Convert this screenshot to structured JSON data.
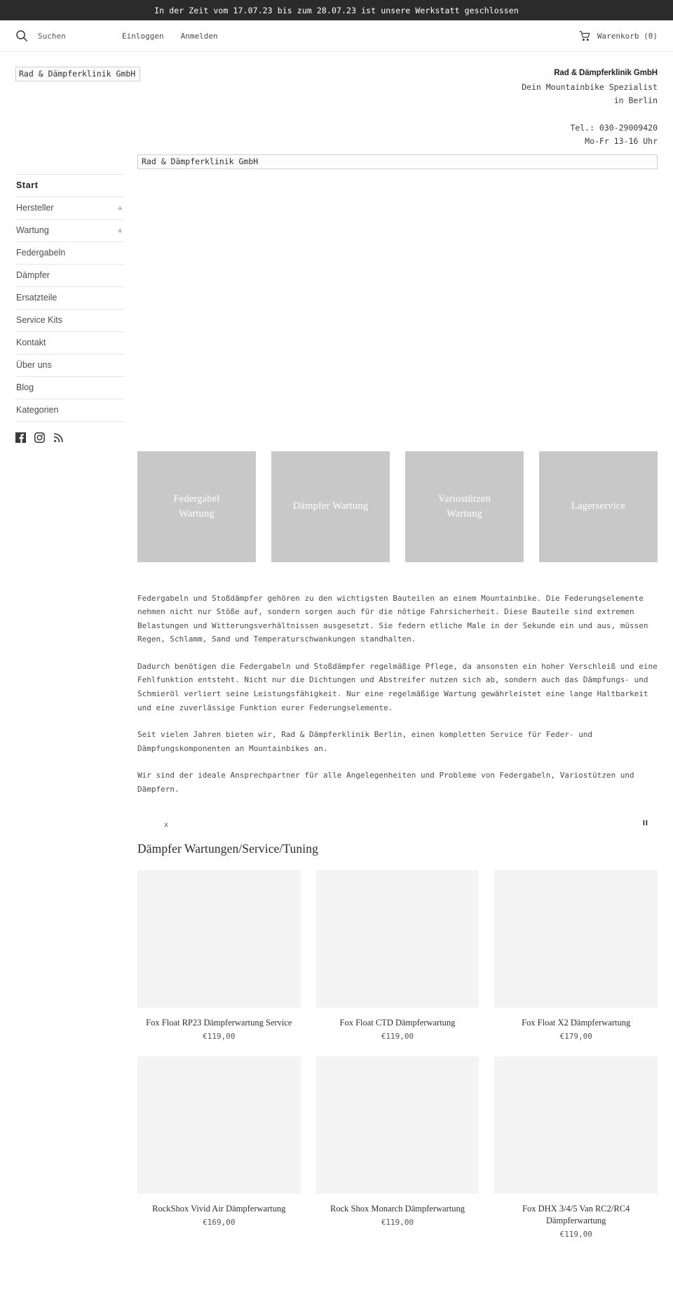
{
  "announcement": {
    "text": "In der Zeit vom 17.07.23 bis zum 28.07.23 ist unsere Werkstatt geschlossen"
  },
  "topbar": {
    "search_placeholder": "Suchen",
    "search_value": "",
    "search_icon": "search-icon",
    "links": [
      {
        "label": "Einloggen"
      },
      {
        "label": "Anmelden"
      }
    ],
    "cart_icon": "shopping-cart-icon",
    "cart_label": "Warenkorb (0)"
  },
  "header": {
    "logo_alt": "Rad & Dämpferklinik GmbH",
    "contact": {
      "company": "Rad & Dämpferklinik GmbH",
      "line1": "Dein Mountainbike Spezialist",
      "line2": "in Berlin",
      "phone": "Tel.: 030-29009420",
      "hours": "Mo-Fr 13-16 Uhr"
    }
  },
  "sidebar": {
    "items": [
      {
        "label": "Start",
        "expandable": false,
        "active": true,
        "toggle": ""
      },
      {
        "label": "Hersteller",
        "expandable": true,
        "active": false,
        "toggle": "+"
      },
      {
        "label": "Wartung",
        "expandable": true,
        "active": false,
        "toggle": "+"
      },
      {
        "label": "Federgabeln",
        "expandable": false,
        "active": false,
        "toggle": ""
      },
      {
        "label": "Dämpfer",
        "expandable": false,
        "active": false,
        "toggle": ""
      },
      {
        "label": "Ersatzteile",
        "expandable": false,
        "active": false,
        "toggle": ""
      },
      {
        "label": "Service Kits",
        "expandable": false,
        "active": false,
        "toggle": ""
      },
      {
        "label": "Kontakt",
        "expandable": false,
        "active": false,
        "toggle": ""
      },
      {
        "label": "Über uns",
        "expandable": false,
        "active": false,
        "toggle": ""
      },
      {
        "label": "Blog",
        "expandable": false,
        "active": false,
        "toggle": ""
      },
      {
        "label": "Kategorien",
        "expandable": false,
        "active": false,
        "toggle": ""
      }
    ],
    "social": [
      {
        "name": "facebook-icon"
      },
      {
        "name": "instagram-icon"
      },
      {
        "name": "rss-icon"
      }
    ]
  },
  "main": {
    "banner_alt": "Rad & Dämpferklinik GmbH",
    "tiles": [
      {
        "line1": "Federgabel",
        "line2": "Wartung"
      },
      {
        "line1": "Dämpfer Wartung",
        "line2": ""
      },
      {
        "line1": "Variostützen",
        "line2": "Wartung"
      },
      {
        "line1": "Lagerservice",
        "line2": ""
      }
    ],
    "paragraphs": [
      "Federgabeln und Stoßdämpfer gehören zu den wichtigsten Bauteilen an einem Mountainbike. Die Federungselemente nehmen nicht nur Stöße auf, sondern sorgen auch für die nötige Fahrsicherheit. Diese Bauteile sind extremen Belastungen und Witterungsverhältnissen ausgesetzt. Sie federn etliche Male in der Sekunde ein und aus, müssen Regen, Schlamm, Sand und Temperaturschwankungen standhalten.",
      "Dadurch benötigen die Federgabeln und Stoßdämpfer regelmäßige Pflege, da ansonsten ein hoher Verschleiß und eine Fehlfunktion entsteht. Nicht nur die Dichtungen und Abstreifer nutzen sich ab, sondern auch das Dämpfungs- und Schmieröl verliert seine Leistungsfähigkeit. Nur eine regelmäßige Wartung gewährleistet eine lange Haltbarkeit und eine zuverlässige Funktion eurer Federungselemente.",
      "Seit vielen Jahren bieten wir, Rad & Dämpferklinik Berlin, einen kompletten Service für Feder- und Dämpfungskomponenten an Mountainbikes an.",
      "Wir sind der ideale Ansprechpartner für alle Angelegenheiten und Probleme von Federgabeln, Variostützen und Dämpfern."
    ],
    "slider": {
      "marker": "x",
      "pause_label": "II"
    },
    "collection": {
      "title": "Dämpfer Wartungen/Service/Tuning",
      "products": [
        {
          "title": "Fox Float RP23 Dämpferwartung Service",
          "price": "€119,00"
        },
        {
          "title": "Fox Float CTD Dämpferwartung",
          "price": "€119,00"
        },
        {
          "title": "Fox Float X2 Dämpferwartung",
          "price": "€179,00"
        },
        {
          "title": "RockShox Vivid Air Dämpferwartung",
          "price": "€169,00"
        },
        {
          "title": "Rock Shox Monarch Dämpferwartung",
          "price": "€119,00"
        },
        {
          "title": "Fox DHX 3/4/5 Van RC2/RC4 Dämpferwartung",
          "price": "€119,00"
        }
      ]
    }
  },
  "colors": {
    "announcement_bg": "#2b2b2b",
    "tile_bg": "#c8c8c8",
    "thumb_bg": "#f4f4f4",
    "text": "#4a4a4a"
  }
}
